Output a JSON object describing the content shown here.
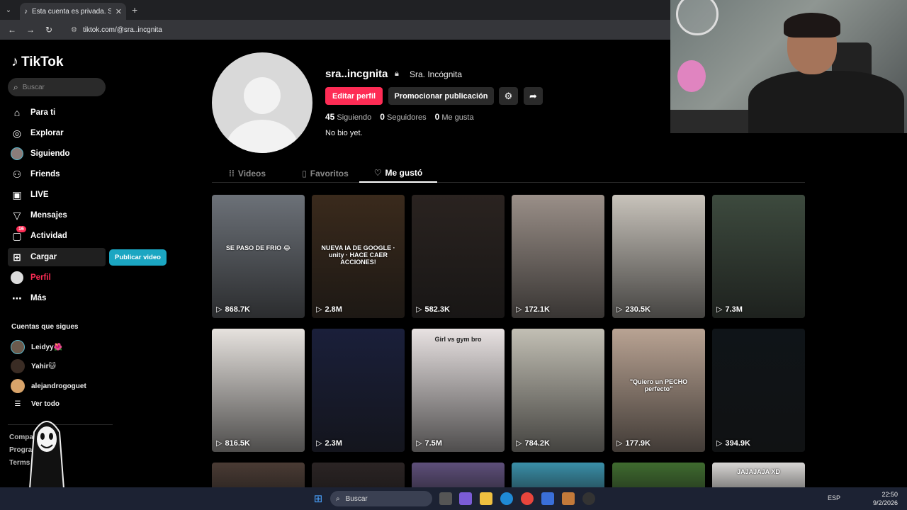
{
  "browser": {
    "tab_title": "Esta cuenta es privada. Sigue e",
    "url": "tiktok.com/@sra..incgnita"
  },
  "sidebar": {
    "logo": "TikTok",
    "search_placeholder": "Buscar",
    "nav": [
      {
        "label": "Para ti",
        "icon": "home-icon"
      },
      {
        "label": "Explorar",
        "icon": "compass-icon"
      },
      {
        "label": "Siguiendo",
        "icon": "avatar-icon"
      },
      {
        "label": "Friends",
        "icon": "friends-icon"
      },
      {
        "label": "LIVE",
        "icon": "live-icon"
      },
      {
        "label": "Mensajes",
        "icon": "send-icon"
      },
      {
        "label": "Actividad",
        "icon": "inbox-icon",
        "badge": "16"
      },
      {
        "label": "Cargar",
        "icon": "plus-square-icon"
      },
      {
        "label": "Perfil",
        "icon": "avatar-icon"
      },
      {
        "label": "Más",
        "icon": "more-icon"
      }
    ],
    "upload_tooltip": "Publicar video",
    "following_title": "Cuentas que sigues",
    "following": [
      {
        "name": "Leidyy🌺"
      },
      {
        "name": "Yahir🐱"
      },
      {
        "name": "alejandrogoguet"
      }
    ],
    "see_all": "Ver todo",
    "footer": [
      "Company",
      "Program",
      "Terms"
    ]
  },
  "profile": {
    "username": "sra..incgnita",
    "nickname": "Sra. Incógnita",
    "edit_button": "Editar perfil",
    "promote_button": "Promocionar publicación",
    "stats": [
      {
        "value": "45",
        "label": "Siguiendo"
      },
      {
        "value": "0",
        "label": "Seguidores"
      },
      {
        "value": "0",
        "label": "Me gusta"
      }
    ],
    "bio": "No bio yet."
  },
  "tabs": [
    {
      "label": "Videos",
      "icon": "grid-icon"
    },
    {
      "label": "Favoritos",
      "icon": "bookmark-icon"
    },
    {
      "label": "Me gustó",
      "icon": "heart-outline-icon",
      "active": true
    }
  ],
  "videos": [
    {
      "views": "868.7K",
      "caption": "SE PASO DE FRIO 😂",
      "bg": "#6c7178"
    },
    {
      "views": "2.8M",
      "caption": "NUEVA IA DE GOOGLE · unity · HACE CAER ACCIONES!",
      "bg": "#3a2a1c"
    },
    {
      "views": "582.3K",
      "caption": "",
      "bg": "#2a2320"
    },
    {
      "views": "172.1K",
      "caption": "",
      "bg": "#9a8f88"
    },
    {
      "views": "230.5K",
      "caption": "",
      "bg": "#c8c3bb"
    },
    {
      "views": "7.3M",
      "caption": "",
      "bg": "#3d4a3e"
    },
    {
      "views": "816.5K",
      "caption": "",
      "bg": "#e6e2de"
    },
    {
      "views": "2.3M",
      "caption": "",
      "bg": "#1a1f3a"
    },
    {
      "views": "7.5M",
      "caption": "Girl vs gym bro",
      "bg": "#e8e2e2"
    },
    {
      "views": "784.2K",
      "caption": "",
      "bg": "#c2bfb4"
    },
    {
      "views": "177.9K",
      "caption": "\"Quiero un PECHO perfecto\"",
      "bg": "#b9a393"
    },
    {
      "views": "394.9K",
      "caption": "",
      "bg": "#0f1418"
    },
    {
      "views": "",
      "caption": "",
      "bg": "#4a3b34"
    },
    {
      "views": "",
      "caption": "",
      "bg": "#2b2424"
    },
    {
      "views": "",
      "caption": "",
      "bg": "#5e4f7a"
    },
    {
      "views": "",
      "caption": "",
      "bg": "#3a8fa8"
    },
    {
      "views": "",
      "caption": "",
      "bg": "#3f6b2f"
    },
    {
      "views": "",
      "caption": "JAJAJAJA XD",
      "bg": "#d8d6d4"
    }
  ],
  "taskbar": {
    "search": "Buscar",
    "lang": "ESP",
    "time": "22:50",
    "date": "9/2/2026"
  },
  "colors": {
    "accent": "#fe2c55",
    "tooltip": "#1ba6c2"
  }
}
